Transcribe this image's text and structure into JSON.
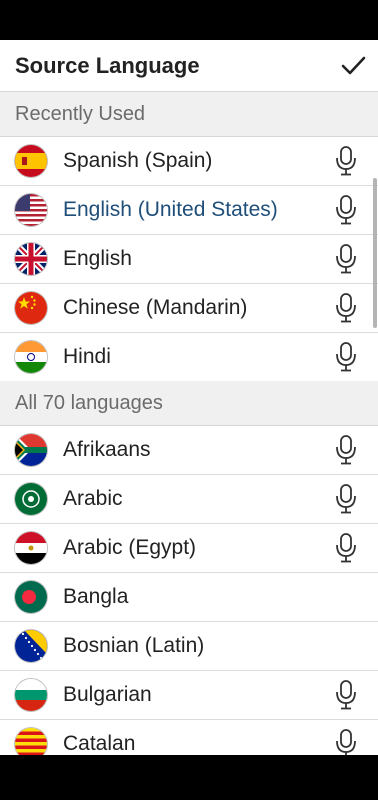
{
  "header": {
    "title": "Source Language",
    "confirm_icon": "checkmark-icon"
  },
  "sections": {
    "recent": "Recently Used",
    "all": "All 70 languages"
  },
  "recent": [
    {
      "label": "Spanish (Spain)",
      "flag": "spain-flag-icon",
      "mic": true
    },
    {
      "label": "English (United States)",
      "flag": "usa-flag-icon",
      "mic": true,
      "selected": true
    },
    {
      "label": "English",
      "flag": "uk-flag-icon",
      "mic": true
    },
    {
      "label": "Chinese (Mandarin)",
      "flag": "china-flag-icon",
      "mic": true
    },
    {
      "label": "Hindi",
      "flag": "india-flag-icon",
      "mic": true
    }
  ],
  "all": [
    {
      "label": "Afrikaans",
      "flag": "south-africa-flag-icon",
      "mic": true
    },
    {
      "label": "Arabic",
      "flag": "arab-league-flag-icon",
      "mic": true
    },
    {
      "label": "Arabic (Egypt)",
      "flag": "egypt-flag-icon",
      "mic": true
    },
    {
      "label": "Bangla",
      "flag": "bangladesh-flag-icon",
      "mic": false
    },
    {
      "label": "Bosnian (Latin)",
      "flag": "bosnia-flag-icon",
      "mic": false
    },
    {
      "label": "Bulgarian",
      "flag": "bulgaria-flag-icon",
      "mic": true
    },
    {
      "label": "Catalan",
      "flag": "catalonia-flag-icon",
      "mic": true
    }
  ],
  "colors": {
    "selected_text": "#1f4e79",
    "section_bg": "#f0f0f0",
    "divider": "#dcdcdc"
  }
}
